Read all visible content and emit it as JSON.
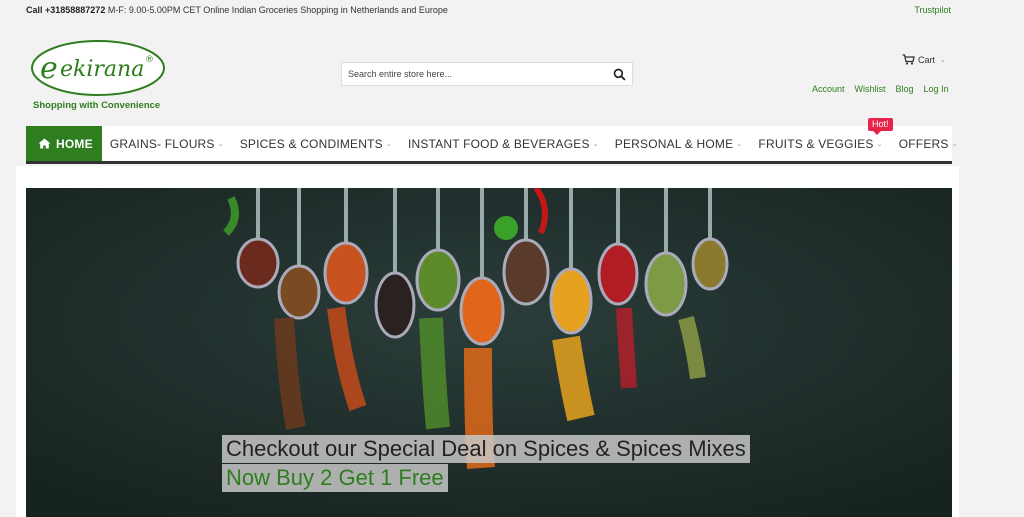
{
  "topbar": {
    "call_label": "Call +31858887272",
    "hours": " M-F: 9.00-5.00PM CET  Online Indian Groceries Shopping in Netherlands and Europe",
    "trustpilot": "Trustpilot"
  },
  "logo": {
    "brand": "ekirana",
    "tagline": "Shopping with Convenience",
    "mark": "®"
  },
  "search": {
    "placeholder": "Search entire store here..."
  },
  "cart": {
    "label": "Cart"
  },
  "account_links": [
    "Account",
    "Wishlist",
    "Blog",
    "Log In"
  ],
  "nav": {
    "home": "HOME",
    "items": [
      "GRAINS- FLOURS",
      "SPICES & CONDIMENTS",
      "INSTANT FOOD & BEVERAGES",
      "PERSONAL & HOME",
      "FRUITS & VEGGIES",
      "OFFERS"
    ],
    "badge": "Hot!"
  },
  "hero": {
    "line1": "Checkout our Special Deal on Spices & Spices Mixes",
    "line2": "Now Buy 2 Get 1 Free"
  },
  "colors": {
    "brand_green": "#2e7d1f",
    "badge_red": "#e8234a"
  }
}
